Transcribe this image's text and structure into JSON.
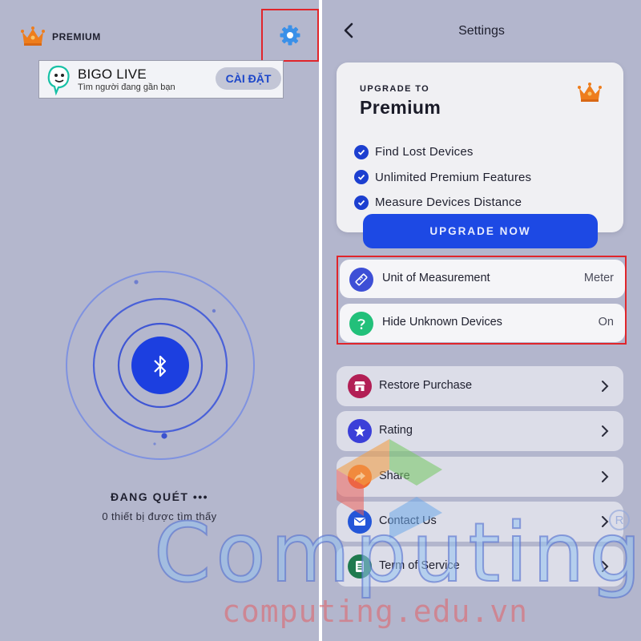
{
  "left_panel": {
    "premium_label": "PREMIUM",
    "ad": {
      "title": "BIGO LIVE",
      "subtitle": "Tìm người đang gần bạn",
      "button": "CÀI ĐẶT"
    },
    "scan_status": "ĐANG QUÉT •••",
    "found_count_text": "0 thiết bị được tìm thấy"
  },
  "right_panel": {
    "title": "Settings",
    "upgrade_card": {
      "eyebrow": "UPGRADE TO",
      "title": "Premium",
      "features": [
        "Find Lost Devices",
        "Unlimited Premium Features",
        "Measure Devices Distance"
      ],
      "button": "UPGRADE NOW"
    },
    "preferences": [
      {
        "label": "Unit of Measurement",
        "value": "Meter",
        "icon": "ruler-icon",
        "color": "#3d4fd6"
      },
      {
        "label": "Hide Unknown Devices",
        "value": "On",
        "icon": "question-icon",
        "color": "#22c07a"
      }
    ],
    "menu": [
      {
        "label": "Restore Purchase",
        "icon": "store-icon",
        "color": "#b21f55"
      },
      {
        "label": "Rating",
        "icon": "star-icon",
        "color": "#3b3fd8"
      },
      {
        "label": "Share",
        "icon": "share-icon",
        "color": "#f26a2a"
      },
      {
        "label": "Contact Us",
        "icon": "mail-icon",
        "color": "#2356d8"
      },
      {
        "label": "Term of Service",
        "icon": "document-icon",
        "color": "#1f7a4e"
      }
    ]
  },
  "watermark": {
    "brand": "Computing",
    "registered": "R",
    "url": "computing.edu.vn"
  },
  "colors": {
    "accent_blue": "#1d49e4",
    "highlight_red": "#e0252b",
    "crown_orange": "#ee7d1c",
    "gear_blue": "#3a90e8"
  }
}
